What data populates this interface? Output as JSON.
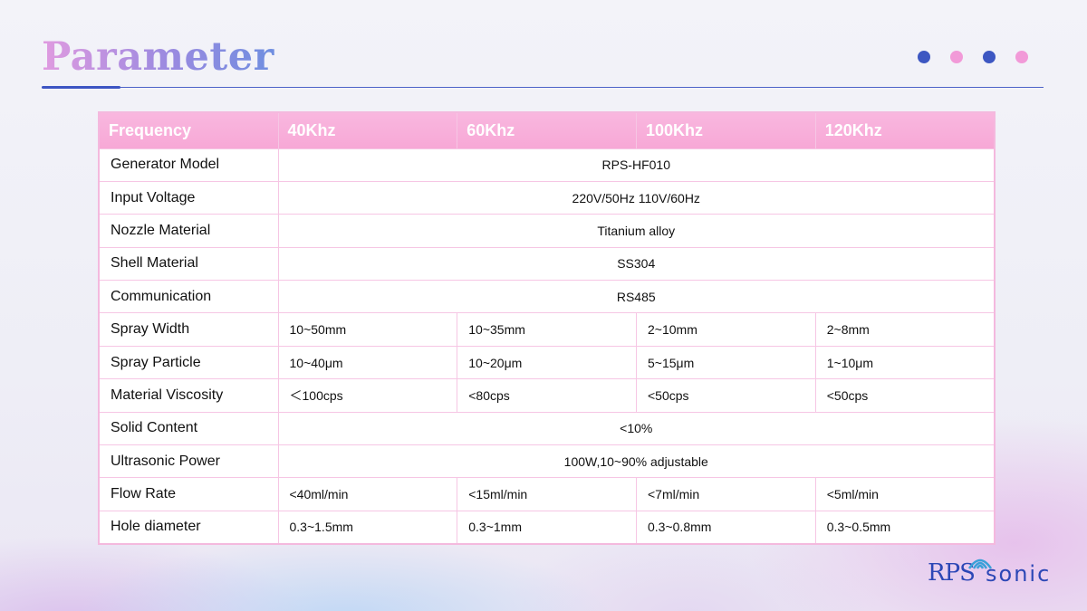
{
  "title": "Parameter",
  "colors": {
    "accent_blue": "#3d57c2",
    "accent_pink": "#f29ad8",
    "header_pink": "#f7a8d6"
  },
  "table": {
    "header": [
      "Frequency",
      "40Khz",
      "60Khz",
      "100Khz",
      "120Khz"
    ],
    "rows": [
      {
        "label": "Generator Model",
        "span": "RPS-HF010"
      },
      {
        "label": "Input Voltage",
        "span": "220V/50Hz  110V/60Hz"
      },
      {
        "label": "Nozzle Material",
        "span": "Titanium alloy"
      },
      {
        "label": "Shell Material",
        "span": "SS304"
      },
      {
        "label": "Communication",
        "span": "RS485"
      },
      {
        "label": "Spray Width",
        "cells": [
          "10~50mm",
          "10~35mm",
          "2~10mm",
          "2~8mm"
        ]
      },
      {
        "label": "Spray Particle",
        "cells": [
          "10~40μm",
          "10~20μm",
          "5~15μm",
          "1~10μm"
        ]
      },
      {
        "label": "Material Viscosity",
        "cells": [
          "＜100cps",
          "<80cps",
          "<50cps",
          "<50cps"
        ]
      },
      {
        "label": "Solid Content",
        "span": "<10%"
      },
      {
        "label": "Ultrasonic Power",
        "span": "100W,10~90% adjustable"
      },
      {
        "label": "Flow Rate",
        "cells": [
          "<40ml/min",
          "<15ml/min",
          "<7ml/min",
          "<5ml/min"
        ]
      },
      {
        "label": "Hole diameter",
        "cells": [
          "0.3~1.5mm",
          "0.3~1mm",
          "0.3~0.8mm",
          "0.3~0.5mm"
        ]
      }
    ]
  },
  "logo": {
    "part1": "RPS",
    "part2": "sonic",
    "icon": "wave-icon"
  }
}
